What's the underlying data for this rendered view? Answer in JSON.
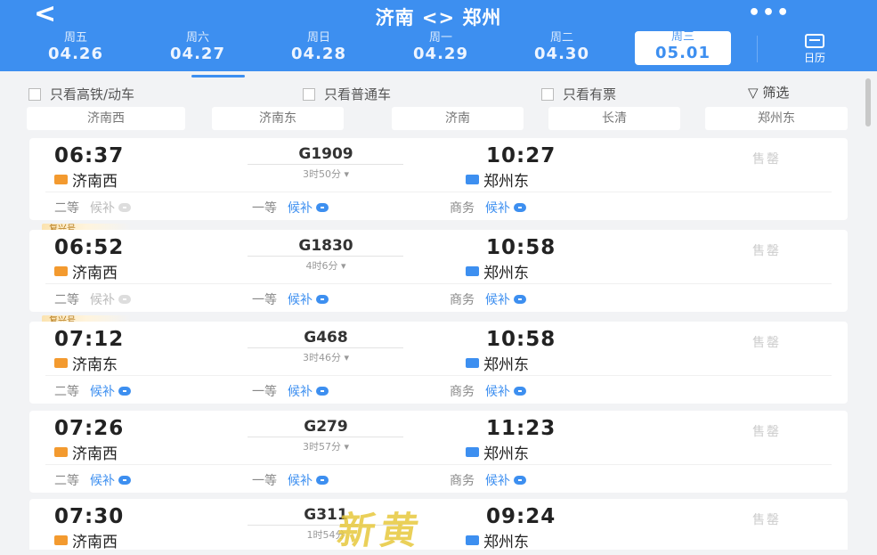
{
  "header": {
    "back_glyph": "<",
    "title": "济南 <> 郑州",
    "more_glyph": "•••",
    "calendar_label": "日历",
    "accent": "#3d8ff0"
  },
  "dates": [
    {
      "weekday": "周五",
      "date": "04.26"
    },
    {
      "weekday": "周六",
      "date": "04.27"
    },
    {
      "weekday": "周日",
      "date": "04.28"
    },
    {
      "weekday": "周一",
      "date": "04.29"
    },
    {
      "weekday": "周二",
      "date": "04.30"
    },
    {
      "weekday": "周三",
      "date": "05.01",
      "selected": true
    }
  ],
  "filters": {
    "high_speed_only": "只看高铁/动车",
    "normal_only": "只看普通车",
    "available_only": "只看有票",
    "filter_label": "筛选"
  },
  "stations": [
    "济南西",
    "济南东",
    "济南",
    "长清",
    "郑州东"
  ],
  "trains": [
    {
      "fuxing": "",
      "dep_time": "06:37",
      "dep_station": "济南西",
      "train_no": "G1909",
      "duration": "3时50分",
      "arr_time": "10:27",
      "arr_station": "郑州东",
      "status": "售罄",
      "seats": [
        {
          "class": "二等",
          "status": "候补",
          "available": false
        },
        {
          "class": "一等",
          "status": "候补",
          "available": true
        },
        {
          "class": "商务",
          "status": "候补",
          "available": true
        }
      ]
    },
    {
      "fuxing": "复兴号",
      "dep_time": "06:52",
      "dep_station": "济南西",
      "train_no": "G1830",
      "duration": "4时6分",
      "arr_time": "10:58",
      "arr_station": "郑州东",
      "status": "售罄",
      "seats": [
        {
          "class": "二等",
          "status": "候补",
          "available": false
        },
        {
          "class": "一等",
          "status": "候补",
          "available": true
        },
        {
          "class": "商务",
          "status": "候补",
          "available": true
        }
      ]
    },
    {
      "fuxing": "复兴号",
      "dep_time": "07:12",
      "dep_station": "济南东",
      "train_no": "G468",
      "duration": "3时46分",
      "arr_time": "10:58",
      "arr_station": "郑州东",
      "status": "售罄",
      "seats": [
        {
          "class": "二等",
          "status": "候补",
          "available": true
        },
        {
          "class": "一等",
          "status": "候补",
          "available": true
        },
        {
          "class": "商务",
          "status": "候补",
          "available": true
        }
      ]
    },
    {
      "fuxing": "",
      "dep_time": "07:26",
      "dep_station": "济南西",
      "train_no": "G279",
      "duration": "3时57分",
      "arr_time": "11:23",
      "arr_station": "郑州东",
      "status": "售罄",
      "seats": [
        {
          "class": "二等",
          "status": "候补",
          "available": true
        },
        {
          "class": "一等",
          "status": "候补",
          "available": true
        },
        {
          "class": "商务",
          "status": "候补",
          "available": true
        }
      ]
    },
    {
      "fuxing": "",
      "dep_time": "07:30",
      "dep_station": "济南西",
      "train_no": "G311",
      "duration": "1时54分",
      "arr_time": "09:24",
      "arr_station": "郑州东",
      "status": "售罄",
      "seats": []
    }
  ],
  "watermark": "新黄"
}
